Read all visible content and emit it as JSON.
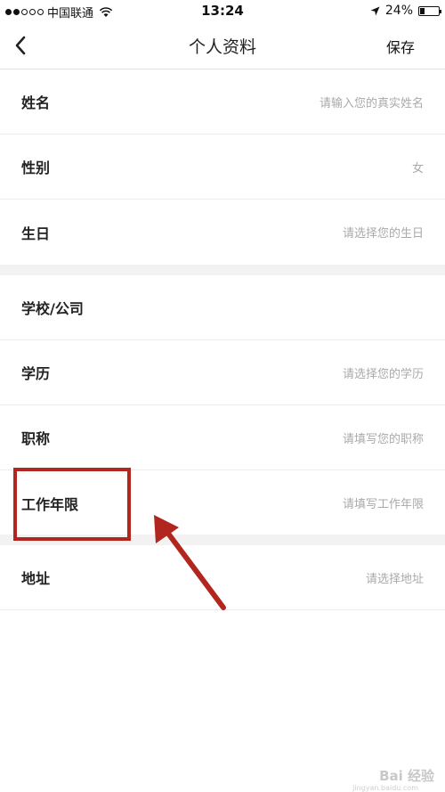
{
  "status_bar": {
    "carrier": "中国联通",
    "time": "13:24",
    "battery": "24%",
    "battery_level": 0.24
  },
  "nav": {
    "title": "个人资料",
    "save_label": "保存"
  },
  "section1": [
    {
      "label": "姓名",
      "value": "请输入您的真实姓名"
    },
    {
      "label": "性别",
      "value": "女"
    },
    {
      "label": "生日",
      "value": "请选择您的生日"
    }
  ],
  "section2": [
    {
      "label": "学校/公司",
      "value": ""
    },
    {
      "label": "学历",
      "value": "请选择您的学历"
    },
    {
      "label": "职称",
      "value": "请填写您的职称"
    },
    {
      "label": "工作年限",
      "value": "请填写工作年限"
    }
  ],
  "section3": [
    {
      "label": "地址",
      "value": "请选择地址"
    }
  ],
  "watermark": {
    "text": "Bai 经验",
    "sub": "jingyan.baidu.com"
  },
  "colors": {
    "annotation": "#b1261f",
    "placeholder": "#a9a9a9",
    "gap": "#f2f2f2"
  }
}
